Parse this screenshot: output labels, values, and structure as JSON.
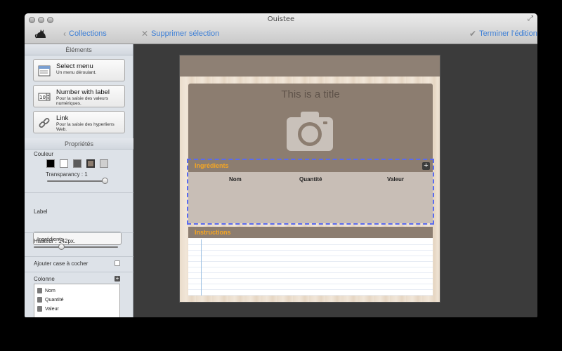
{
  "window": {
    "title": "Ouistee"
  },
  "toolbar": {
    "collections": "Collections",
    "delete_selection": "Supprimer sélection",
    "finish_editing": "Terminer l'édition"
  },
  "sidebar": {
    "elements_heading": "Éléments",
    "elements": [
      {
        "title": "Select menu",
        "desc": "Un menu déroulant.",
        "icon": "select-menu-icon"
      },
      {
        "title": "Number with label",
        "desc": "Pour la saisie des valeurs numériques.",
        "icon": "number-stepper-icon"
      },
      {
        "title": "Link",
        "desc": "Pour la saisie des hyperliens Web.",
        "icon": "link-icon"
      }
    ],
    "properties_heading": "Propriétés",
    "color_label": "Couleur",
    "colors": [
      "#000000",
      "#ffffff",
      "#5a5a5a",
      "#8c7d70",
      "#cfcfcf"
    ],
    "transparency_label": "Transparancy : 1",
    "transparency_value": 1,
    "label_heading": "Label",
    "label_value": "Ingrédients",
    "height_label": "Hauteur : 142px.",
    "height_value": 142,
    "checkbox_label": "Ajouter case à cocher",
    "columns_heading": "Colonne",
    "columns": [
      "Nom",
      "Quantité",
      "Valeur"
    ]
  },
  "document": {
    "title": "This is a title",
    "ingredients_title": "Ingrédients",
    "ingredient_columns": [
      "Nom",
      "Quantité",
      "Valeur"
    ],
    "instructions_title": "Instructions"
  },
  "colors": {
    "accent_link": "#3d7fd6",
    "section_title": "#f5a623",
    "selection": "#5a6bf0"
  }
}
